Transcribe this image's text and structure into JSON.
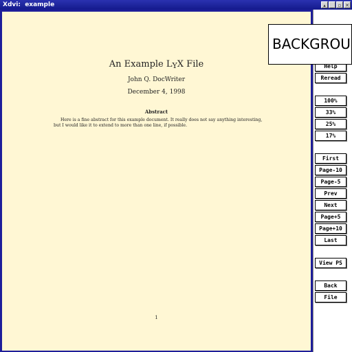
{
  "window": {
    "title": "Xdvi:  example",
    "controls": [
      "▴",
      "_",
      "▫",
      "✕"
    ]
  },
  "document": {
    "title": "An Example LYX File",
    "author": "John Q. DocWriter",
    "date": "December 4, 1998",
    "abstract_heading": "Abstract",
    "abstract_text": "Here is a fine abstract for this example document. It really does not say anything interesting, but I would like it to extend to more than one line, if possible.",
    "page_number": "1"
  },
  "sidebar": {
    "help": "Help",
    "reread": "Reread",
    "zoom_100": "100%",
    "zoom_33": "33%",
    "zoom_25": "25%",
    "zoom_17": "17%",
    "first": "First",
    "page_minus_10": "Page-10",
    "page_minus_5": "Page-5",
    "prev": "Prev",
    "next": "Next",
    "page_plus_5": "Page+5",
    "page_plus_10": "Page+10",
    "last": "Last",
    "view_ps": "View PS",
    "back": "Back",
    "file": "File"
  },
  "overlay": {
    "text": "BACKGROU"
  }
}
